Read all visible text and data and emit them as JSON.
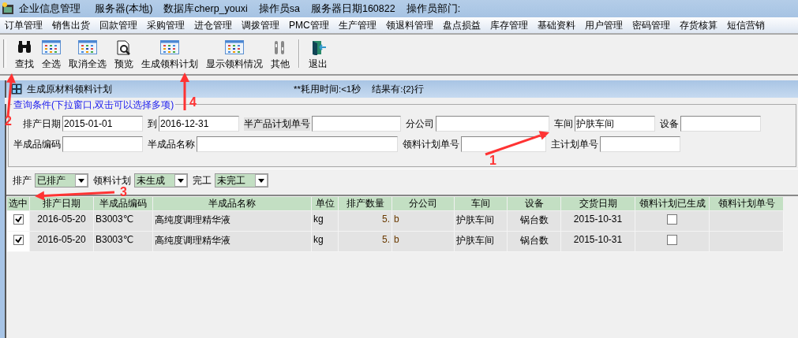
{
  "window": {
    "title_items": [
      "企业信息管理",
      "服务器(本地)",
      "数据库cherp_youxi",
      "操作员sa",
      "服务器日期160822",
      "操作员部门:"
    ]
  },
  "menu": [
    "订单管理",
    "销售出货",
    "回款管理",
    "采购管理",
    "进仓管理",
    "调拨管理",
    "PMC管理",
    "生产管理",
    "领退料管理",
    "盘点损益",
    "库存管理",
    "基础资料",
    "用户管理",
    "密码管理",
    "存货核算",
    "短信营销"
  ],
  "toolbar": [
    "查找",
    "全选",
    "取消全选",
    "预览",
    "生成领料计划",
    "显示领料情况",
    "其他",
    "退出"
  ],
  "child_window": {
    "title": "生成原材料领料计划",
    "elapsed": "**耗用时间:<1秒",
    "results": "结果有:{2}行"
  },
  "query_group": {
    "legend": "查询条件(下拉窗口,双击可以选择多项)",
    "fields": [
      {
        "label": "排产日期",
        "value": "2015-01-01"
      },
      {
        "label": "到",
        "value": "2016-12-31"
      },
      {
        "label": "半产品计划单号",
        "shaded": true
      },
      {
        "label": "分公司"
      },
      {
        "label": "车间",
        "value": "护肤车间"
      },
      {
        "label": "设备"
      },
      {
        "label": "半成品编码"
      },
      {
        "label": "半成品名称"
      },
      {
        "label": "领料计划单号"
      },
      {
        "label": "主计划单号"
      }
    ]
  },
  "filters": [
    {
      "label": "排产",
      "value": "已排产"
    },
    {
      "label": "领料计划",
      "value": "未生成"
    },
    {
      "label": "完工",
      "value": "未完工"
    }
  ],
  "table": {
    "columns": [
      "选中",
      "排产日期",
      "半成品编码",
      "半成品名称",
      "单位",
      "排产数量",
      "分公司",
      "车间",
      "设备",
      "交货日期",
      "领料计划已生成",
      "领料计划单号"
    ],
    "rows": [
      {
        "cells": [
          {
            "kind": "checkbox",
            "checked": true
          },
          {
            "kind": "text",
            "text": "2016-05-20"
          },
          {
            "kind": "text",
            "text": "B3003℃"
          },
          {
            "kind": "text",
            "text": "高纯度调理精华液"
          },
          {
            "kind": "text",
            "text": "kg"
          },
          {
            "kind": "text",
            "text": "5."
          },
          {
            "kind": "text",
            "text": "b"
          },
          {
            "kind": "text",
            "text": "护肤车间"
          },
          {
            "kind": "text",
            "text": "锅台数"
          },
          {
            "kind": "text",
            "text": "2015-10-31"
          },
          {
            "kind": "checkbox",
            "checked": false
          },
          {
            "kind": "text"
          }
        ]
      },
      {
        "cells": [
          {
            "kind": "checkbox",
            "checked": true
          },
          {
            "kind": "text",
            "text": "2016-05-20"
          },
          {
            "kind": "text",
            "text": "B3003℃"
          },
          {
            "kind": "text",
            "text": "高纯度调理精华液"
          },
          {
            "kind": "text",
            "text": "kg"
          },
          {
            "kind": "text",
            "text": "5."
          },
          {
            "kind": "text",
            "text": "b"
          },
          {
            "kind": "text",
            "text": "护肤车间"
          },
          {
            "kind": "text",
            "text": "锅台数"
          },
          {
            "kind": "text",
            "text": "2015-10-31"
          },
          {
            "kind": "checkbox",
            "checked": false
          },
          {
            "kind": "text"
          }
        ]
      }
    ]
  },
  "annotations": [
    "1",
    "2",
    "3",
    "4"
  ]
}
